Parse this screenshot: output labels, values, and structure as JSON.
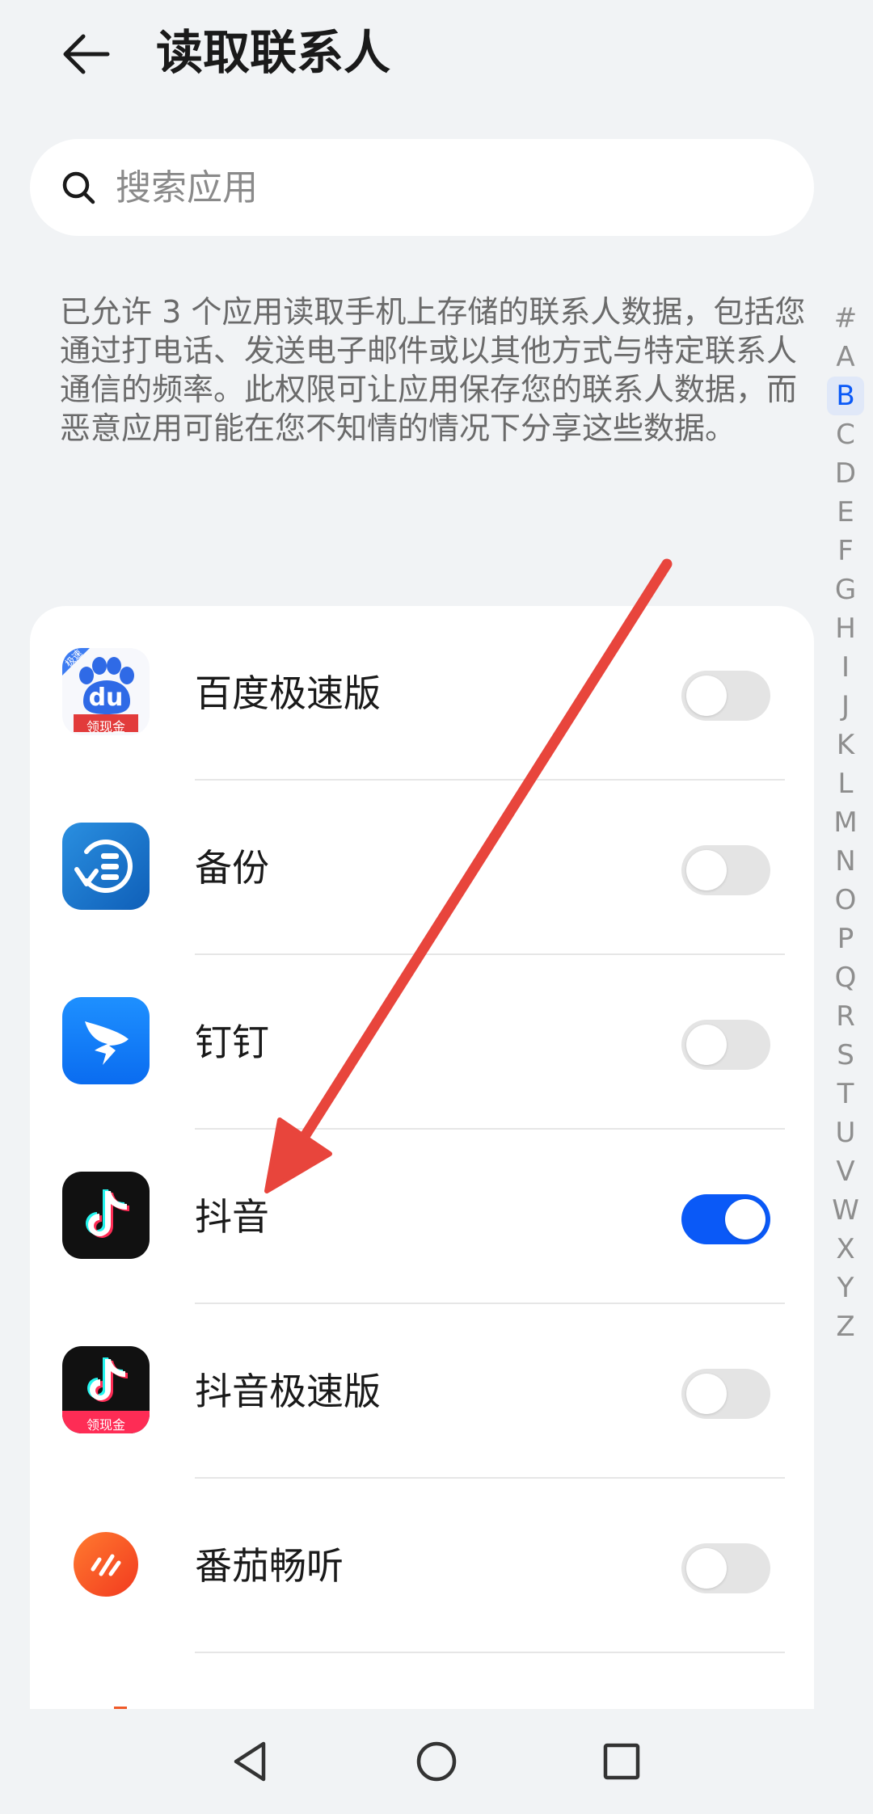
{
  "header": {
    "title": "读取联系人",
    "back_icon": "back-arrow-icon"
  },
  "search": {
    "placeholder": "搜索应用",
    "value": "",
    "icon": "search-icon"
  },
  "description": "已允许 3 个应用读取手机上存储的联系人数据，包括您通过打电话、发送电子邮件或以其他方式与特定联系人通信的频率。此权限可让应用保存您的联系人数据，而恶意应用可能在您不知情的情况下分享这些数据。",
  "index_bar": {
    "letters": [
      "#",
      "A",
      "B",
      "C",
      "D",
      "E",
      "F",
      "G",
      "H",
      "I",
      "J",
      "K",
      "L",
      "M",
      "N",
      "O",
      "P",
      "Q",
      "R",
      "S",
      "T",
      "U",
      "V",
      "W",
      "X",
      "Y",
      "Z"
    ],
    "active": "B"
  },
  "apps": [
    {
      "name": "百度极速版",
      "enabled": false,
      "icon": "baidu-lite-icon",
      "badge_top": "极速",
      "badge_bottom": "领现金",
      "logo_text": "du"
    },
    {
      "name": "备份",
      "enabled": false,
      "icon": "backup-icon"
    },
    {
      "name": "钉钉",
      "enabled": false,
      "icon": "dingtalk-icon"
    },
    {
      "name": "抖音",
      "enabled": true,
      "icon": "douyin-icon"
    },
    {
      "name": "抖音极速版",
      "enabled": false,
      "icon": "douyin-lite-icon",
      "badge_bottom": "领现金"
    },
    {
      "name": "番茄畅听",
      "enabled": false,
      "icon": "fanqie-listen-icon"
    }
  ],
  "colors": {
    "background": "#f1f3f5",
    "accent": "#0a59f7",
    "toggle_off": "#e4e4e4",
    "annotation_arrow": "#e8453c"
  },
  "nav": {
    "back": "nav-back-icon",
    "home": "nav-home-icon",
    "recents": "nav-recents-icon"
  }
}
